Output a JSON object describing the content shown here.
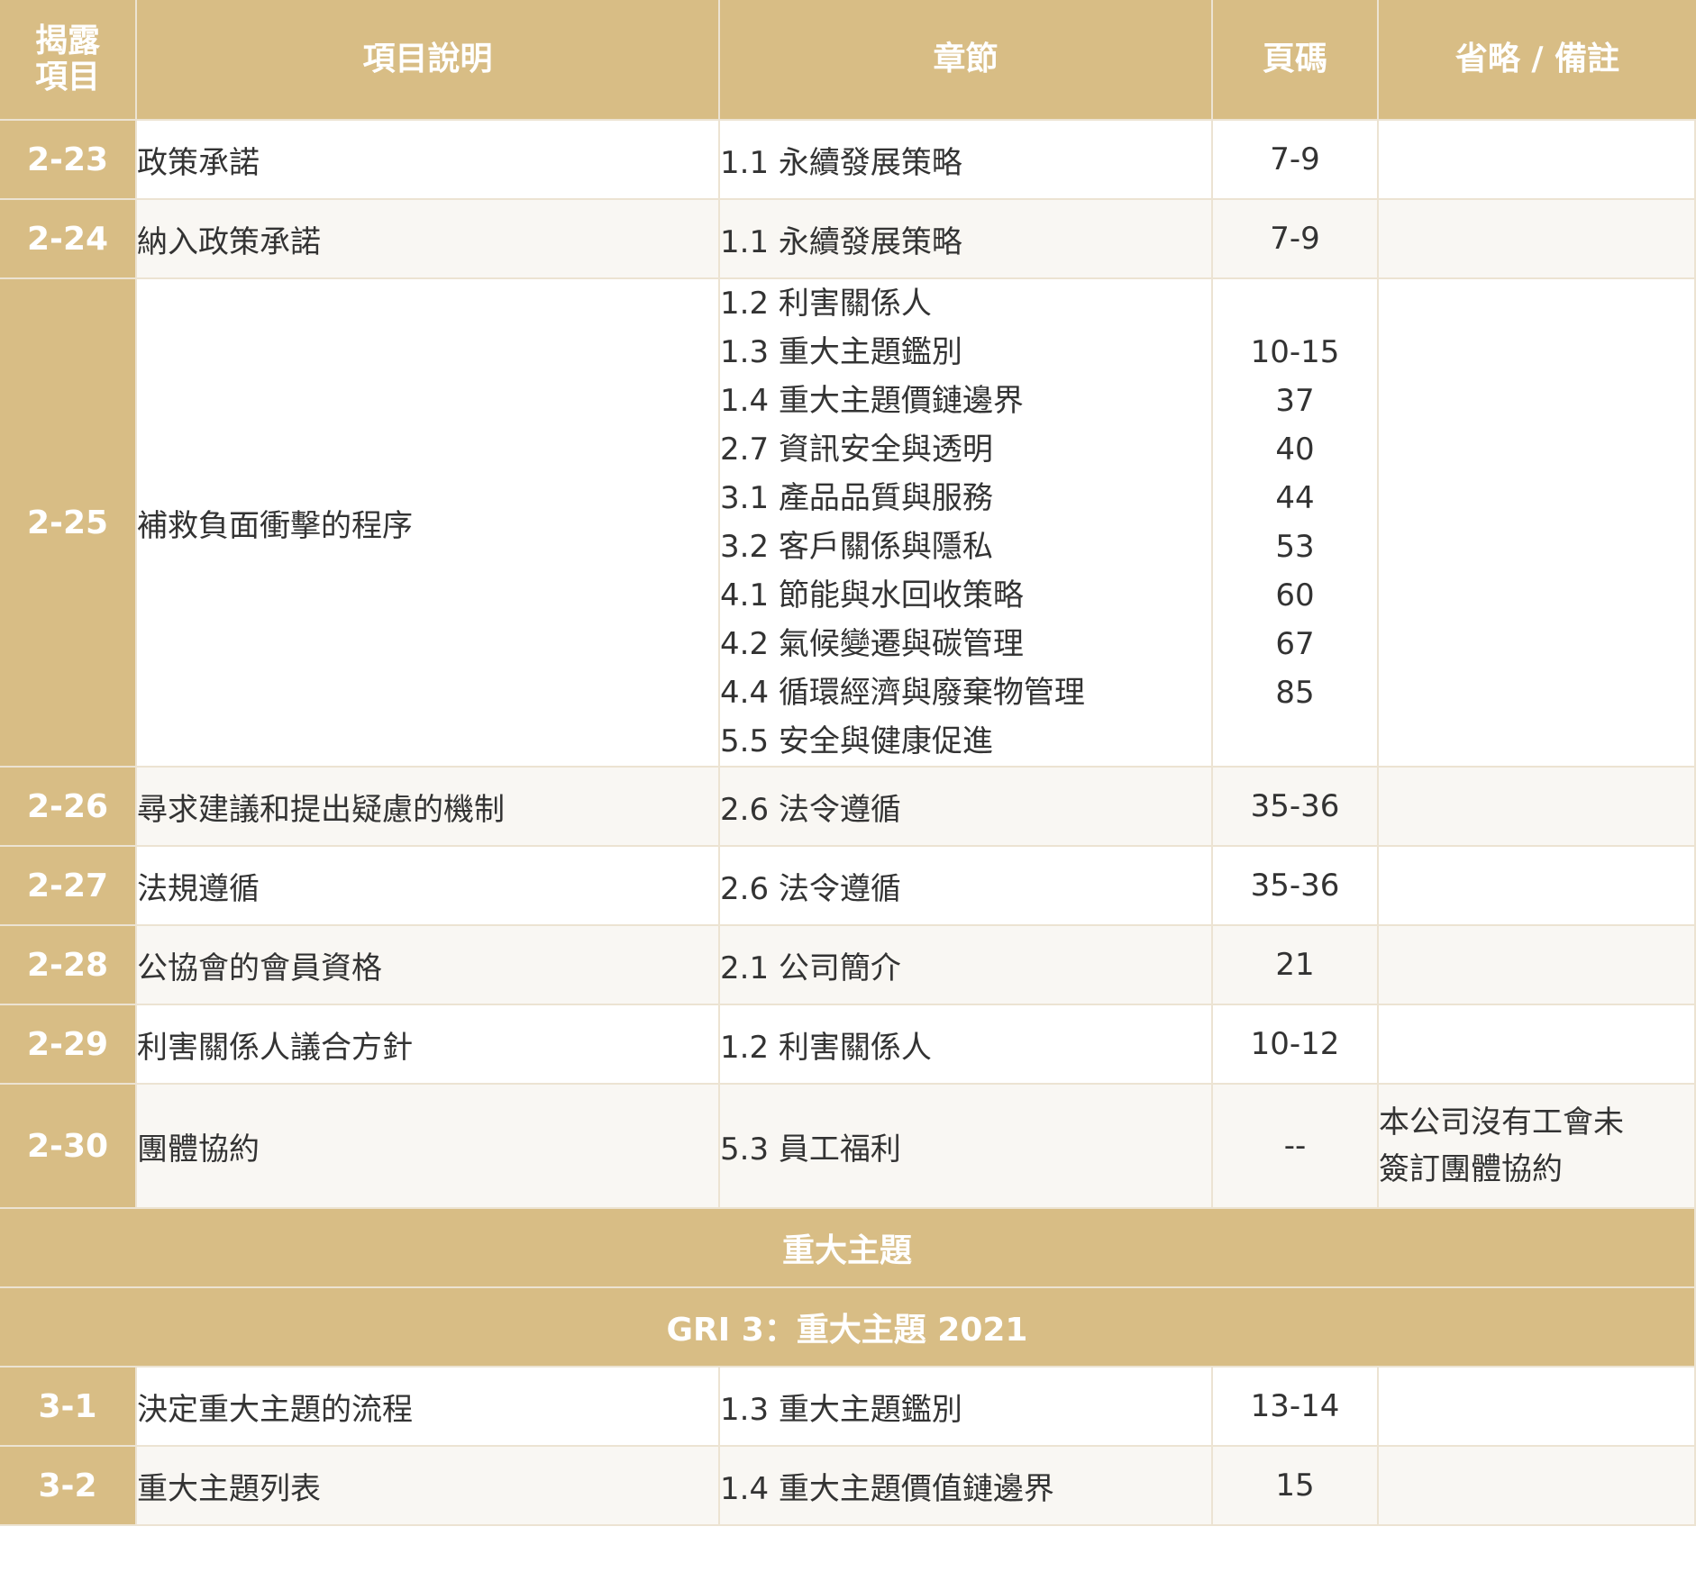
{
  "header": {
    "col_id_line1": "揭露",
    "col_id_line2": "項目",
    "col_desc": "項目說明",
    "col_section": "章節",
    "col_page": "頁碼",
    "col_note": "省略 / 備註"
  },
  "rows_top": [
    {
      "id": "2-23",
      "desc": "政策承諾",
      "section": "1.1 永續發展策略",
      "page": "7-9",
      "note": ""
    },
    {
      "id": "2-24",
      "desc": "納入政策承諾",
      "section": "1.1 永續發展策略",
      "page": "7-9",
      "note": ""
    }
  ],
  "row_225": {
    "id": "2-25",
    "desc": "補救負面衝擊的程序",
    "sections": [
      "1.2 利害關係人",
      "1.3 重大主題鑑別",
      "1.4 重大主題價鏈邊界",
      "2.7 資訊安全與透明",
      "3.1 產品品質與服務",
      "3.2 客戶關係與隱私",
      "4.1 節能與水回收策略",
      "4.2 氣候變遷與碳管理",
      "4.4 循環經濟與廢棄物管理",
      "5.5 安全與健康促進"
    ],
    "pages": [
      "10-15",
      "37",
      "40",
      "44",
      "53",
      "60",
      "67",
      "85"
    ]
  },
  "rows_mid": [
    {
      "id": "2-26",
      "desc": "尋求建議和提出疑慮的機制",
      "section": "2.6 法令遵循",
      "page": "35-36",
      "note": ""
    },
    {
      "id": "2-27",
      "desc": "法規遵循",
      "section": "2.6 法令遵循",
      "page": "35-36",
      "note": ""
    },
    {
      "id": "2-28",
      "desc": "公協會的會員資格",
      "section": "2.1 公司簡介",
      "page": "21",
      "note": ""
    },
    {
      "id": "2-29",
      "desc": "利害關係人議合方針",
      "section": "1.2 利害關係人",
      "page": "10-12",
      "note": ""
    }
  ],
  "row_230": {
    "id": "2-30",
    "desc": "團體協約",
    "section": "5.3 員工福利",
    "page": "--",
    "note_line1": "本公司沒有工會未",
    "note_line2": "簽訂團體協約"
  },
  "band_material": "重大主題",
  "band_gri3": "GRI 3：重大主題 2021",
  "rows_bottom": [
    {
      "id": "3-1",
      "desc": "決定重大主題的流程",
      "section": "1.3 重大主題鑑別",
      "page": "13-14",
      "note": ""
    },
    {
      "id": "3-2",
      "desc": "重大主題列表",
      "section": "1.4 重大主題價值鏈邊界",
      "page": "15",
      "note": ""
    }
  ],
  "colors": {
    "header_gold": "#d8bd85",
    "row_alt": "#f9f7f3",
    "text": "#333333"
  }
}
